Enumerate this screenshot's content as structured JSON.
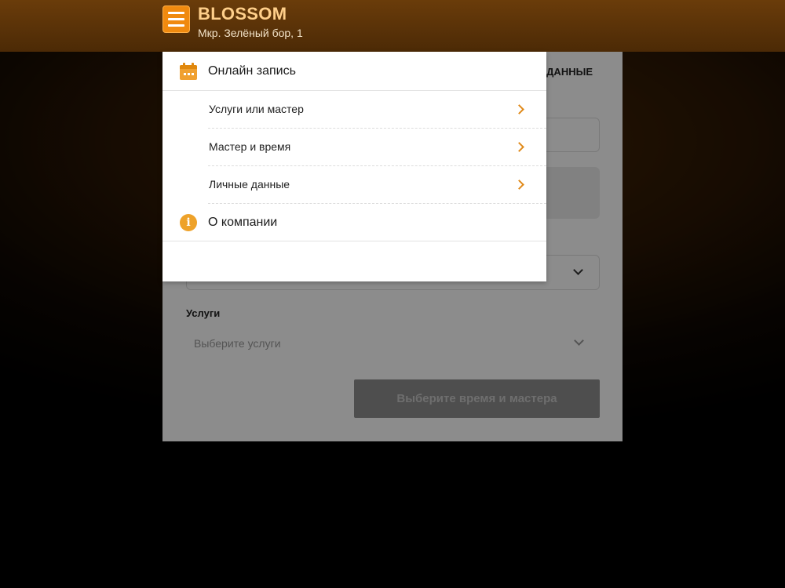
{
  "header": {
    "brand": "BLOSSOM",
    "address": "Мкр. Зелёный бор, 1"
  },
  "panel": {
    "tab_label": "ДАННЫЕ",
    "services_label": "Услуги",
    "services_placeholder": "Выберите услуги",
    "submit_label": "Выберите время и мастера"
  },
  "menu": {
    "online_booking": "Онлайн запись",
    "sub_items": [
      {
        "label": "Услуги или мастер"
      },
      {
        "label": "Мастер и время"
      },
      {
        "label": "Личные данные"
      }
    ],
    "about": "О компании"
  },
  "colors": {
    "accent": "#f08a0f",
    "icon_orange": "#eea22a",
    "arrow": "#e08a1a"
  },
  "icons": {
    "menu": "hamburger-icon",
    "calendar": "calendar-icon",
    "info": "info-icon",
    "chevron": "chevron-right-icon",
    "dropdown": "chevron-down-icon"
  }
}
